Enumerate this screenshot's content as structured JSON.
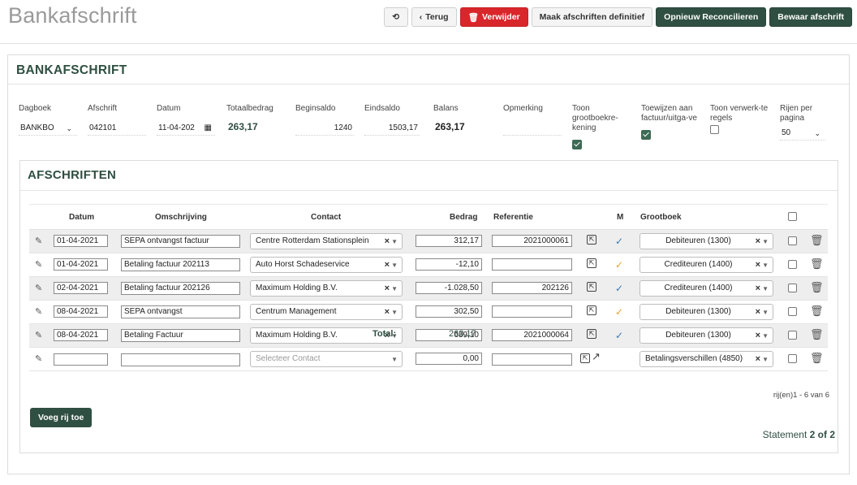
{
  "header": {
    "title": "Bankafschrift",
    "buttons": {
      "back": "Terug",
      "delete": "Verwijder",
      "finalize": "Maak afschriften definitief",
      "reconcile": "Opnieuw Reconcilieren",
      "save": "Bewaar afschrift"
    }
  },
  "form": {
    "section_title": "BANKAFSCHRIFT",
    "fields": {
      "dagboek": {
        "label": "Dagboek",
        "value": "BANKBO"
      },
      "afschrift": {
        "label": "Afschrift",
        "value": "042101"
      },
      "datum": {
        "label": "Datum",
        "value": "11-04-202"
      },
      "totaalbedrag": {
        "label": "Totaalbedrag",
        "value": "263,17"
      },
      "beginsaldo": {
        "label": "Beginsaldo",
        "value": "1240"
      },
      "eindsaldo": {
        "label": "Eindsaldo",
        "value": "1503,17"
      },
      "balans": {
        "label": "Balans",
        "value": "263,17"
      },
      "opmerking": {
        "label": "Opmerking",
        "value": ""
      },
      "toon_grootboek": {
        "label": "Toon grootboekre-kening",
        "checked": true
      },
      "toewijzen": {
        "label": "Toewijzen aan factuur/uitga-ve",
        "checked": true
      },
      "toon_verwerkte": {
        "label": "Toon verwerk-te regels",
        "checked": false
      },
      "rijen": {
        "label": "Rijen per pagina",
        "value": "50"
      }
    }
  },
  "statements": {
    "section_title": "AFSCHRIFTEN",
    "columns": {
      "datum": "Datum",
      "omschrijving": "Omschrijving",
      "contact": "Contact",
      "bedrag": "Bedrag",
      "referentie": "Referentie",
      "m": "M",
      "grootboek": "Grootboek"
    },
    "rows": [
      {
        "datum": "01-04-2021",
        "omschrijving": "SEPA ontvangst factuur",
        "contact": "Centre Rotterdam Stationsplein",
        "bedrag": "312,17",
        "referentie": "2021000061",
        "mark": "✓",
        "mark_color": "blue",
        "grootboek": "Debiteuren (1300)"
      },
      {
        "datum": "01-04-2021",
        "omschrijving": "Betaling factuur 202113",
        "contact": "Auto Horst Schadeservice",
        "bedrag": "-12,10",
        "referentie": "",
        "mark": "✓",
        "mark_color": "orange",
        "grootboek": "Crediteuren (1400)"
      },
      {
        "datum": "02-04-2021",
        "omschrijving": "Betaling factuur 202126",
        "contact": "Maximum Holding B.V.",
        "bedrag": "-1.028,50",
        "referentie": "202126",
        "mark": "✓",
        "mark_color": "blue",
        "grootboek": "Crediteuren (1400)"
      },
      {
        "datum": "08-04-2021",
        "omschrijving": "SEPA ontvangst",
        "contact": "Centrum Management",
        "bedrag": "302,50",
        "referentie": "",
        "mark": "✓",
        "mark_color": "orange",
        "grootboek": "Debiteuren (1300)"
      },
      {
        "datum": "08-04-2021",
        "omschrijving": "Betaling Factuur",
        "contact": "Maximum Holding B.V.",
        "bedrag": "689,10",
        "referentie": "2021000064",
        "mark": "✓",
        "mark_color": "blue",
        "grootboek": "Debiteuren (1300)"
      }
    ],
    "new_row": {
      "contact_placeholder": "Selecteer Contact",
      "bedrag": "0,00",
      "grootboek": "Betalingsverschillen (4850)"
    },
    "total_label": "Total:",
    "total_value": "263,17",
    "rows_info": "rij(en)1 - 6 van 6",
    "add_row_label": "Voeg rij toe",
    "statement_prefix": "Statement",
    "statement_page": "2 of 2"
  },
  "colors": {
    "accent": "#2f4f42",
    "danger": "#d9262a",
    "check_blue": "#3a78b0",
    "check_orange": "#e2a12e"
  }
}
